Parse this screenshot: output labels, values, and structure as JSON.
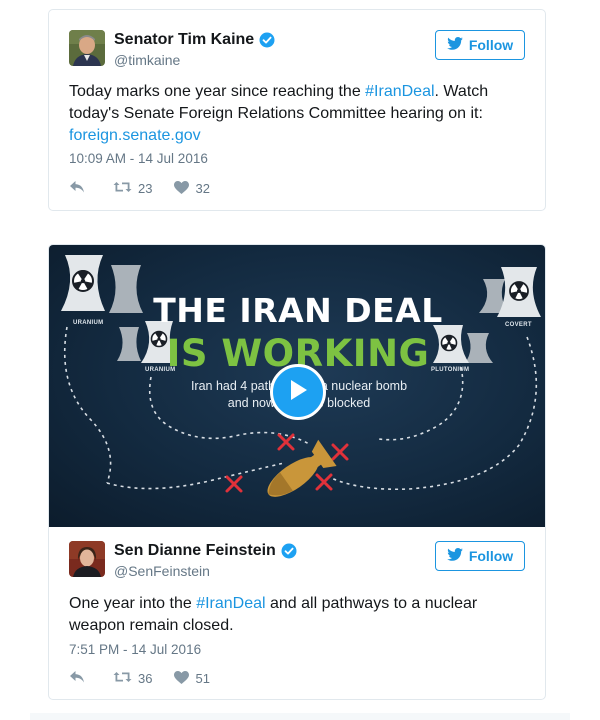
{
  "tweets": [
    {
      "author": "Senator Tim Kaine",
      "handle": "@timkaine",
      "follow_label": "Follow",
      "text_before": "Today marks one year since reaching the ",
      "hashtag": "#IranDeal",
      "text_after": ". Watch today's Senate Foreign Relations Committee hearing on it: ",
      "link": "foreign.senate.gov",
      "timestamp": "10:09 AM - 14 Jul 2016",
      "retweets": "23",
      "likes": "32"
    },
    {
      "author": "Sen Dianne Feinstein",
      "handle": "@SenFeinstein",
      "follow_label": "Follow",
      "text_before": "One year into the ",
      "hashtag": "#IranDeal",
      "text_after": " and all pathways to a nuclear weapon remain closed.",
      "timestamp": "7:51 PM - 14 Jul 2016",
      "retweets": "36",
      "likes": "51",
      "media": {
        "title_line1": "THE IRAN DEAL",
        "title_line2": "IS WORKING",
        "subtitle_line1": "Iran had 4 pathways to a nuclear bomb",
        "subtitle_line2": "and now they are blocked",
        "labels": {
          "uranium_left": "URANIUM",
          "uranium_center": "URANIUM",
          "plutonium": "PLUTONIUM",
          "covert": "COVERT"
        }
      }
    }
  ],
  "colors": {
    "link": "#1b95e0",
    "verified": "#1da1f2",
    "muted": "#657786",
    "green_title": "#7dc242",
    "x_marks": "#e0313a"
  },
  "icons": [
    "verified-icon",
    "twitter-bird-icon",
    "reply-icon",
    "retweet-icon",
    "heart-icon",
    "play-icon",
    "nuclear-icon",
    "bomb-icon"
  ]
}
